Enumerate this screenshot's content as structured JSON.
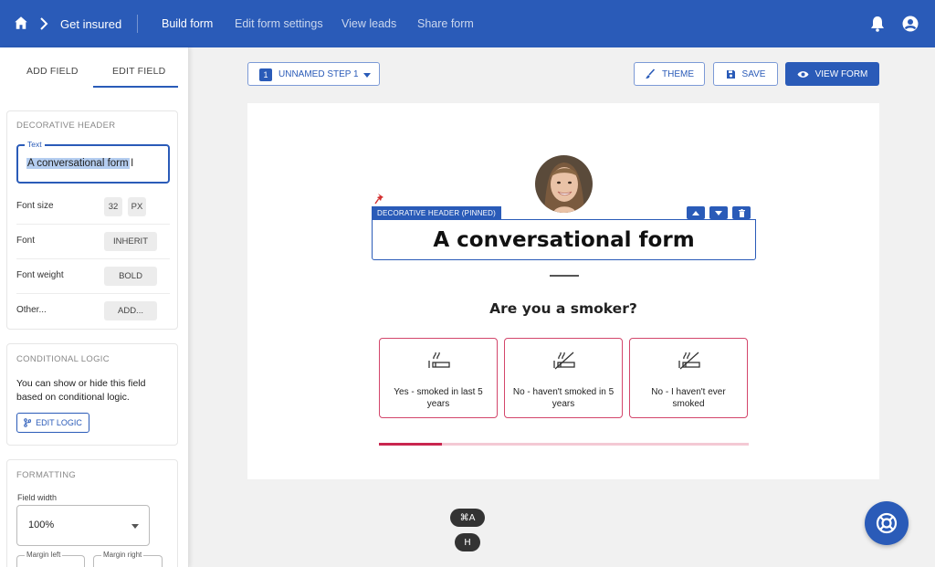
{
  "topbar": {
    "brand": "Get insured",
    "nav": [
      "Build form",
      "Edit form settings",
      "View leads",
      "Share form"
    ],
    "active_index": 0
  },
  "sidebar": {
    "tabs": [
      "ADD FIELD",
      "EDIT FIELD"
    ],
    "active_tab": 1,
    "decorative_header": {
      "title": "DECORATIVE HEADER",
      "text_label": "Text",
      "text_value": "A conversational form",
      "rows": [
        {
          "label": "Font size",
          "chips": [
            "32",
            "PX"
          ]
        },
        {
          "label": "Font",
          "chips": [
            "INHERIT"
          ]
        },
        {
          "label": "Font weight",
          "chips": [
            "BOLD"
          ]
        },
        {
          "label": "Other...",
          "chips": [
            "ADD..."
          ]
        }
      ]
    },
    "conditional_logic": {
      "title": "CONDITIONAL LOGIC",
      "description": "You can show or hide this field based on conditional logic.",
      "button": "EDIT LOGIC"
    },
    "formatting": {
      "title": "FORMATTING",
      "field_width_label": "Field width",
      "field_width_value": "100%",
      "margin_left": "Margin left",
      "margin_right": "Margin right"
    }
  },
  "toolbar": {
    "step_number": "1",
    "step_label": "UNNAMED STEP 1",
    "theme": "THEME",
    "save": "SAVE",
    "view_form": "VIEW FORM"
  },
  "form": {
    "header_tag": "DECORATIVE HEADER (PINNED)",
    "header_text": "A conversational form",
    "question": "Are you a smoker?",
    "options": [
      "Yes - smoked in last 5 years",
      "No - haven't smoked in 5 years",
      "No - I haven't ever smoked"
    ],
    "progress_fraction": 0.17
  },
  "keys": {
    "shortcut": "⌘A",
    "key": "H"
  },
  "colors": {
    "brand": "#2a5bb8",
    "accent": "#d3466b"
  }
}
